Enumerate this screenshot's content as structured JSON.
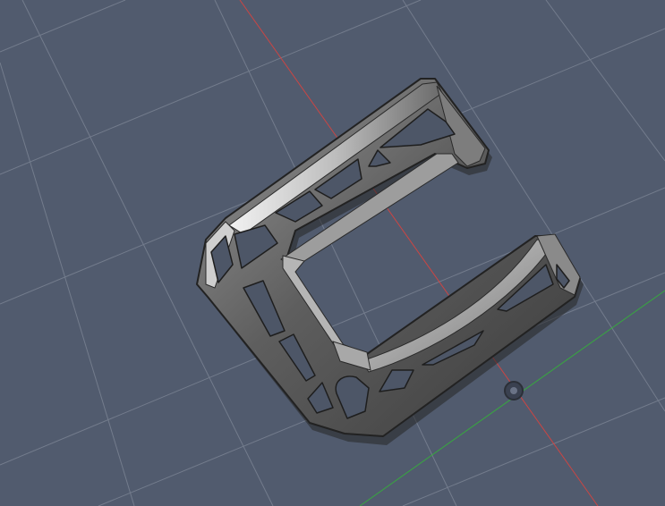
{
  "viewport": {
    "background_color": "#515b6e",
    "grid_color": "#8f97a6",
    "x_axis_color": "#d9433f",
    "y_axis_color": "#35b03a"
  },
  "model": {
    "name": "",
    "material_color": "#5f5f5f",
    "highlight_color": "#e0e0e0",
    "shadow_color": "#2c2c2c"
  },
  "icons": {
    "origin": "origin-marker-icon"
  }
}
